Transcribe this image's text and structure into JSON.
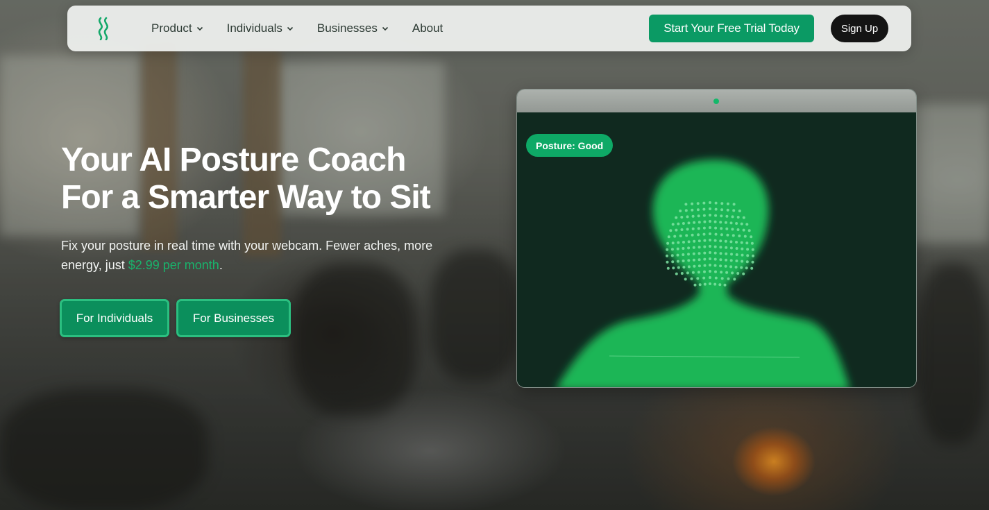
{
  "nav": {
    "items": [
      {
        "label": "Product",
        "has_dropdown": true
      },
      {
        "label": "Individuals",
        "has_dropdown": true
      },
      {
        "label": "Businesses",
        "has_dropdown": true
      },
      {
        "label": "About",
        "has_dropdown": false
      }
    ],
    "trial_button": "Start Your Free Trial Today",
    "signup_button": "Sign Up"
  },
  "hero": {
    "title_line1": "Your AI Posture Coach",
    "title_line2": "For a Smarter Way to Sit",
    "subtitle_prefix": "Fix your posture in real time with your webcam. Fewer aches, more energy, just ",
    "subtitle_price": "$2.99 per month",
    "subtitle_suffix": ".",
    "cta_individuals": "For Individuals",
    "cta_businesses": "For Businesses"
  },
  "webcam": {
    "posture_label": "Posture: Good"
  },
  "colors": {
    "accent": "#0b9a64",
    "price": "#19b36c",
    "badge": "#0ea966",
    "silhouette": "#1db656"
  }
}
